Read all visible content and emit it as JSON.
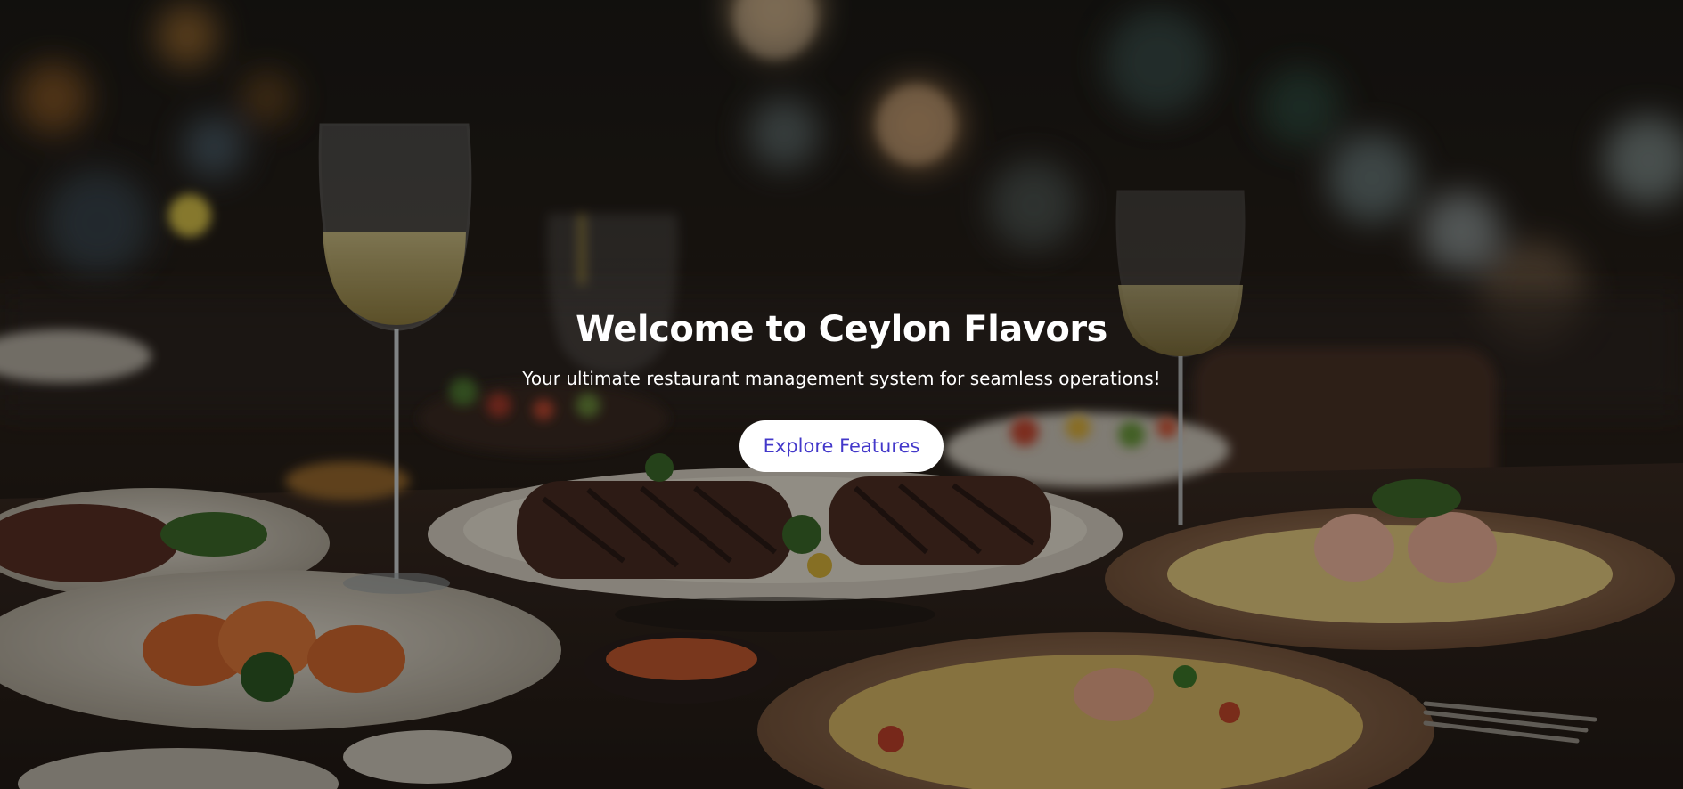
{
  "hero": {
    "title": "Welcome to Ceylon Flavors",
    "subtitle": "Your ultimate restaurant management system for seamless operations!",
    "cta_label": "Explore Features"
  },
  "colors": {
    "title_text": "#ffffff",
    "subtitle_text": "#ffffff",
    "button_background": "#ffffff",
    "button_text": "#4338ca"
  },
  "icons": [
    "restaurant-table-photo"
  ]
}
